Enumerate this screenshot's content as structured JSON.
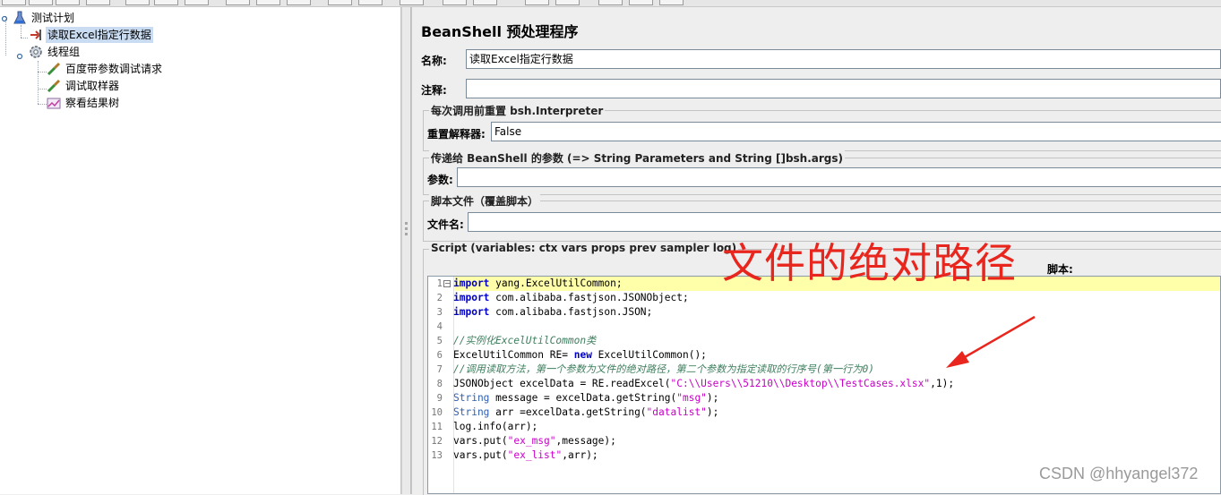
{
  "tree": {
    "items": [
      {
        "label": "测试计划",
        "icon": "test-plan-icon"
      },
      {
        "label": "读取Excel指定行数据",
        "icon": "preprocessor-icon",
        "selected": true
      },
      {
        "label": "线程组",
        "icon": "gear-icon"
      },
      {
        "label": "百度带参数调试请求",
        "icon": "pipette-icon"
      },
      {
        "label": "调试取样器",
        "icon": "pipette-icon"
      },
      {
        "label": "察看结果树",
        "icon": "chart-icon"
      }
    ]
  },
  "panel": {
    "title": "BeanShell 预处理程序",
    "name_label": "名称:",
    "name_value": "读取Excel指定行数据",
    "comment_label": "注释:",
    "comment_value": "",
    "reset_group": "每次调用前重置 bsh.Interpreter",
    "reset_label": "重置解释器:",
    "reset_value": "False",
    "params_group": "传递给 BeanShell 的参数 (=> String Parameters and String []bsh.args)",
    "params_label": "参数:",
    "params_value": "",
    "file_group": "脚本文件（覆盖脚本）",
    "file_label": "文件名:",
    "file_value": "",
    "script_group": "Script (variables: ctx vars props prev sampler log)",
    "script_label": "脚本:"
  },
  "script": {
    "lines": [
      {
        "n": "1",
        "text": "import yang.ExcelUtilCommon;"
      },
      {
        "n": "2",
        "text": "import com.alibaba.fastjson.JSONObject;"
      },
      {
        "n": "3",
        "text": "import com.alibaba.fastjson.JSON;"
      },
      {
        "n": "4",
        "text": ""
      },
      {
        "n": "5",
        "text": "//实例化ExcelUtilCommon类"
      },
      {
        "n": "6",
        "text": "ExcelUtilCommon RE= new ExcelUtilCommon();"
      },
      {
        "n": "7",
        "text": "//调用读取方法，第一个参数为文件的绝对路径，第二个参数为指定读取的行序号(第一行为0)"
      },
      {
        "n": "8",
        "text": "JSONObject excelData = RE.readExcel(\"C:\\\\Users\\\\51210\\\\Desktop\\\\TestCases.xlsx\",1);"
      },
      {
        "n": "9",
        "text": "String message = excelData.getString(\"msg\");"
      },
      {
        "n": "10",
        "text": "String arr =excelData.getString(\"datalist\");"
      },
      {
        "n": "11",
        "text": "log.info(arr);"
      },
      {
        "n": "12",
        "text": "vars.put(\"ex_msg\",message);"
      },
      {
        "n": "13",
        "text": "vars.put(\"ex_list\",arr);"
      }
    ]
  },
  "annotation": {
    "text": "文件的绝对路径",
    "color": "#e8261e"
  },
  "watermark": "CSDN @hhyangel372"
}
